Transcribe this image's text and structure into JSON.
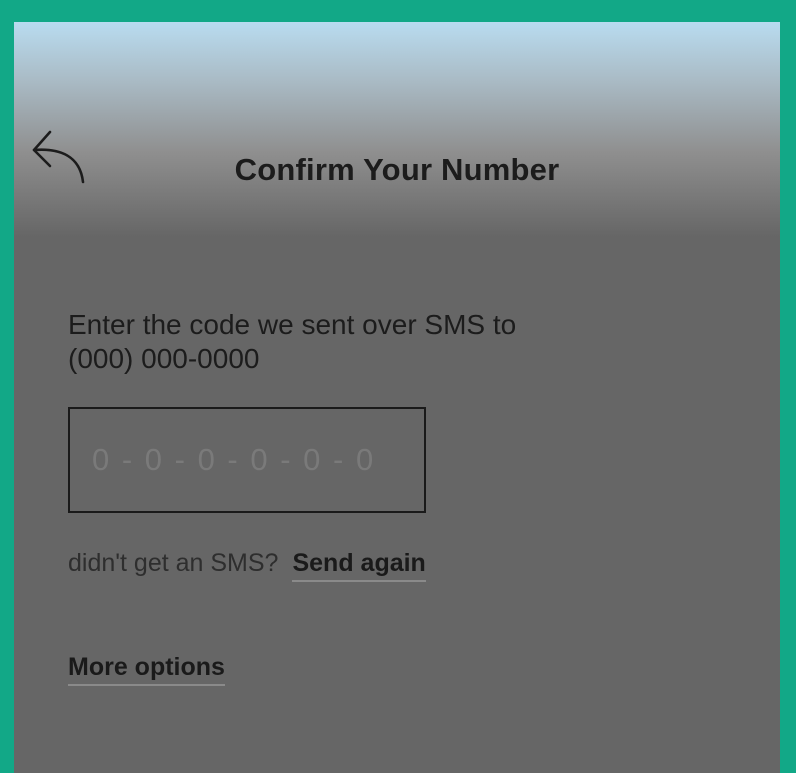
{
  "header": {
    "title": "Confirm Your Number",
    "back_icon": "back-arrow-icon"
  },
  "verification": {
    "instructions_line1": "Enter the code we sent over SMS to",
    "phone_number": "(000) 000-0000",
    "code_placeholder": "0 - 0 - 0 - 0 - 0 - 0",
    "code_value": ""
  },
  "resend": {
    "prompt": "didn't get an SMS?",
    "send_again_label": "Send again"
  },
  "options": {
    "more_options_label": "More options"
  },
  "colors": {
    "frame_border": "#12a887",
    "overlay": "#666666",
    "header_top": "#b9dcf0"
  }
}
